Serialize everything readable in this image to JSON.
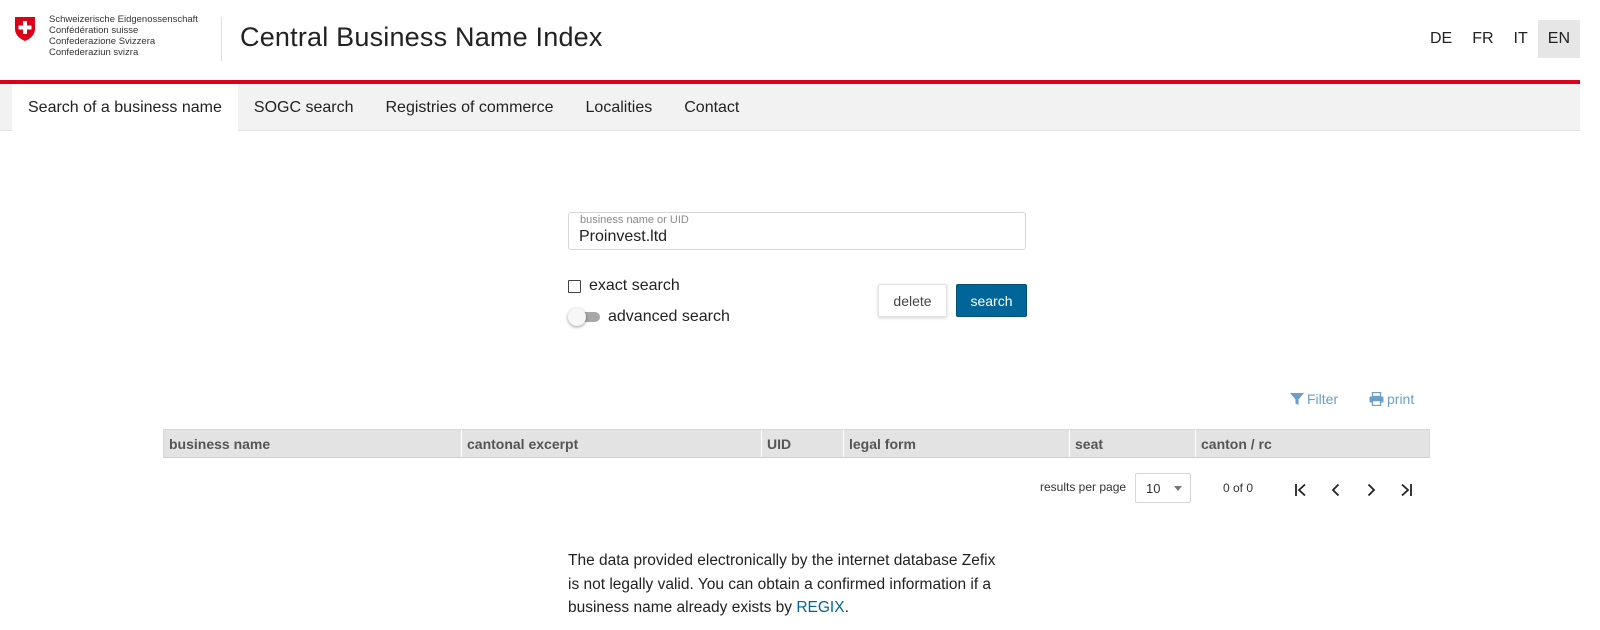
{
  "header": {
    "confederation_lines": [
      "Schweizerische Eidgenossenschaft",
      "Confédération suisse",
      "Confederazione Svizzera",
      "Confederaziun svizra"
    ],
    "title": "Central Business Name Index",
    "languages": [
      "DE",
      "FR",
      "IT",
      "EN"
    ],
    "active_language": "EN"
  },
  "nav": {
    "items": [
      "Search of a business name",
      "SOGC search",
      "Registries of commerce",
      "Localities",
      "Contact"
    ],
    "active": "Search of a business name"
  },
  "search": {
    "field_label": "business name or UID",
    "field_value": "Proinvest.ltd",
    "exact_label": "exact search",
    "exact_checked": false,
    "advanced_label": "advanced search",
    "advanced_on": false,
    "delete_label": "delete",
    "search_label": "search"
  },
  "tools": {
    "filter_label": "Filter",
    "print_label": "print",
    "filter_icon": "filter-icon",
    "print_icon": "printer-icon"
  },
  "table": {
    "columns": [
      "business name",
      "cantonal excerpt",
      "UID",
      "legal form",
      "seat",
      "canton / rc"
    ]
  },
  "pagination": {
    "results_per_page_label": "results per page",
    "results_per_page_value": "10",
    "count_text": "0 of 0"
  },
  "disclaimer": {
    "text": "The data provided electronically by the internet database Zefix is not legally valid. You can obtain a confirmed information if a business name already exists by",
    "link_text": "REGIX",
    "end": "."
  },
  "colors": {
    "brand_red": "#dc0018",
    "primary_blue": "#006699",
    "link_light_blue": "#6b9fc9",
    "nav_background": "#f2f2f2"
  }
}
